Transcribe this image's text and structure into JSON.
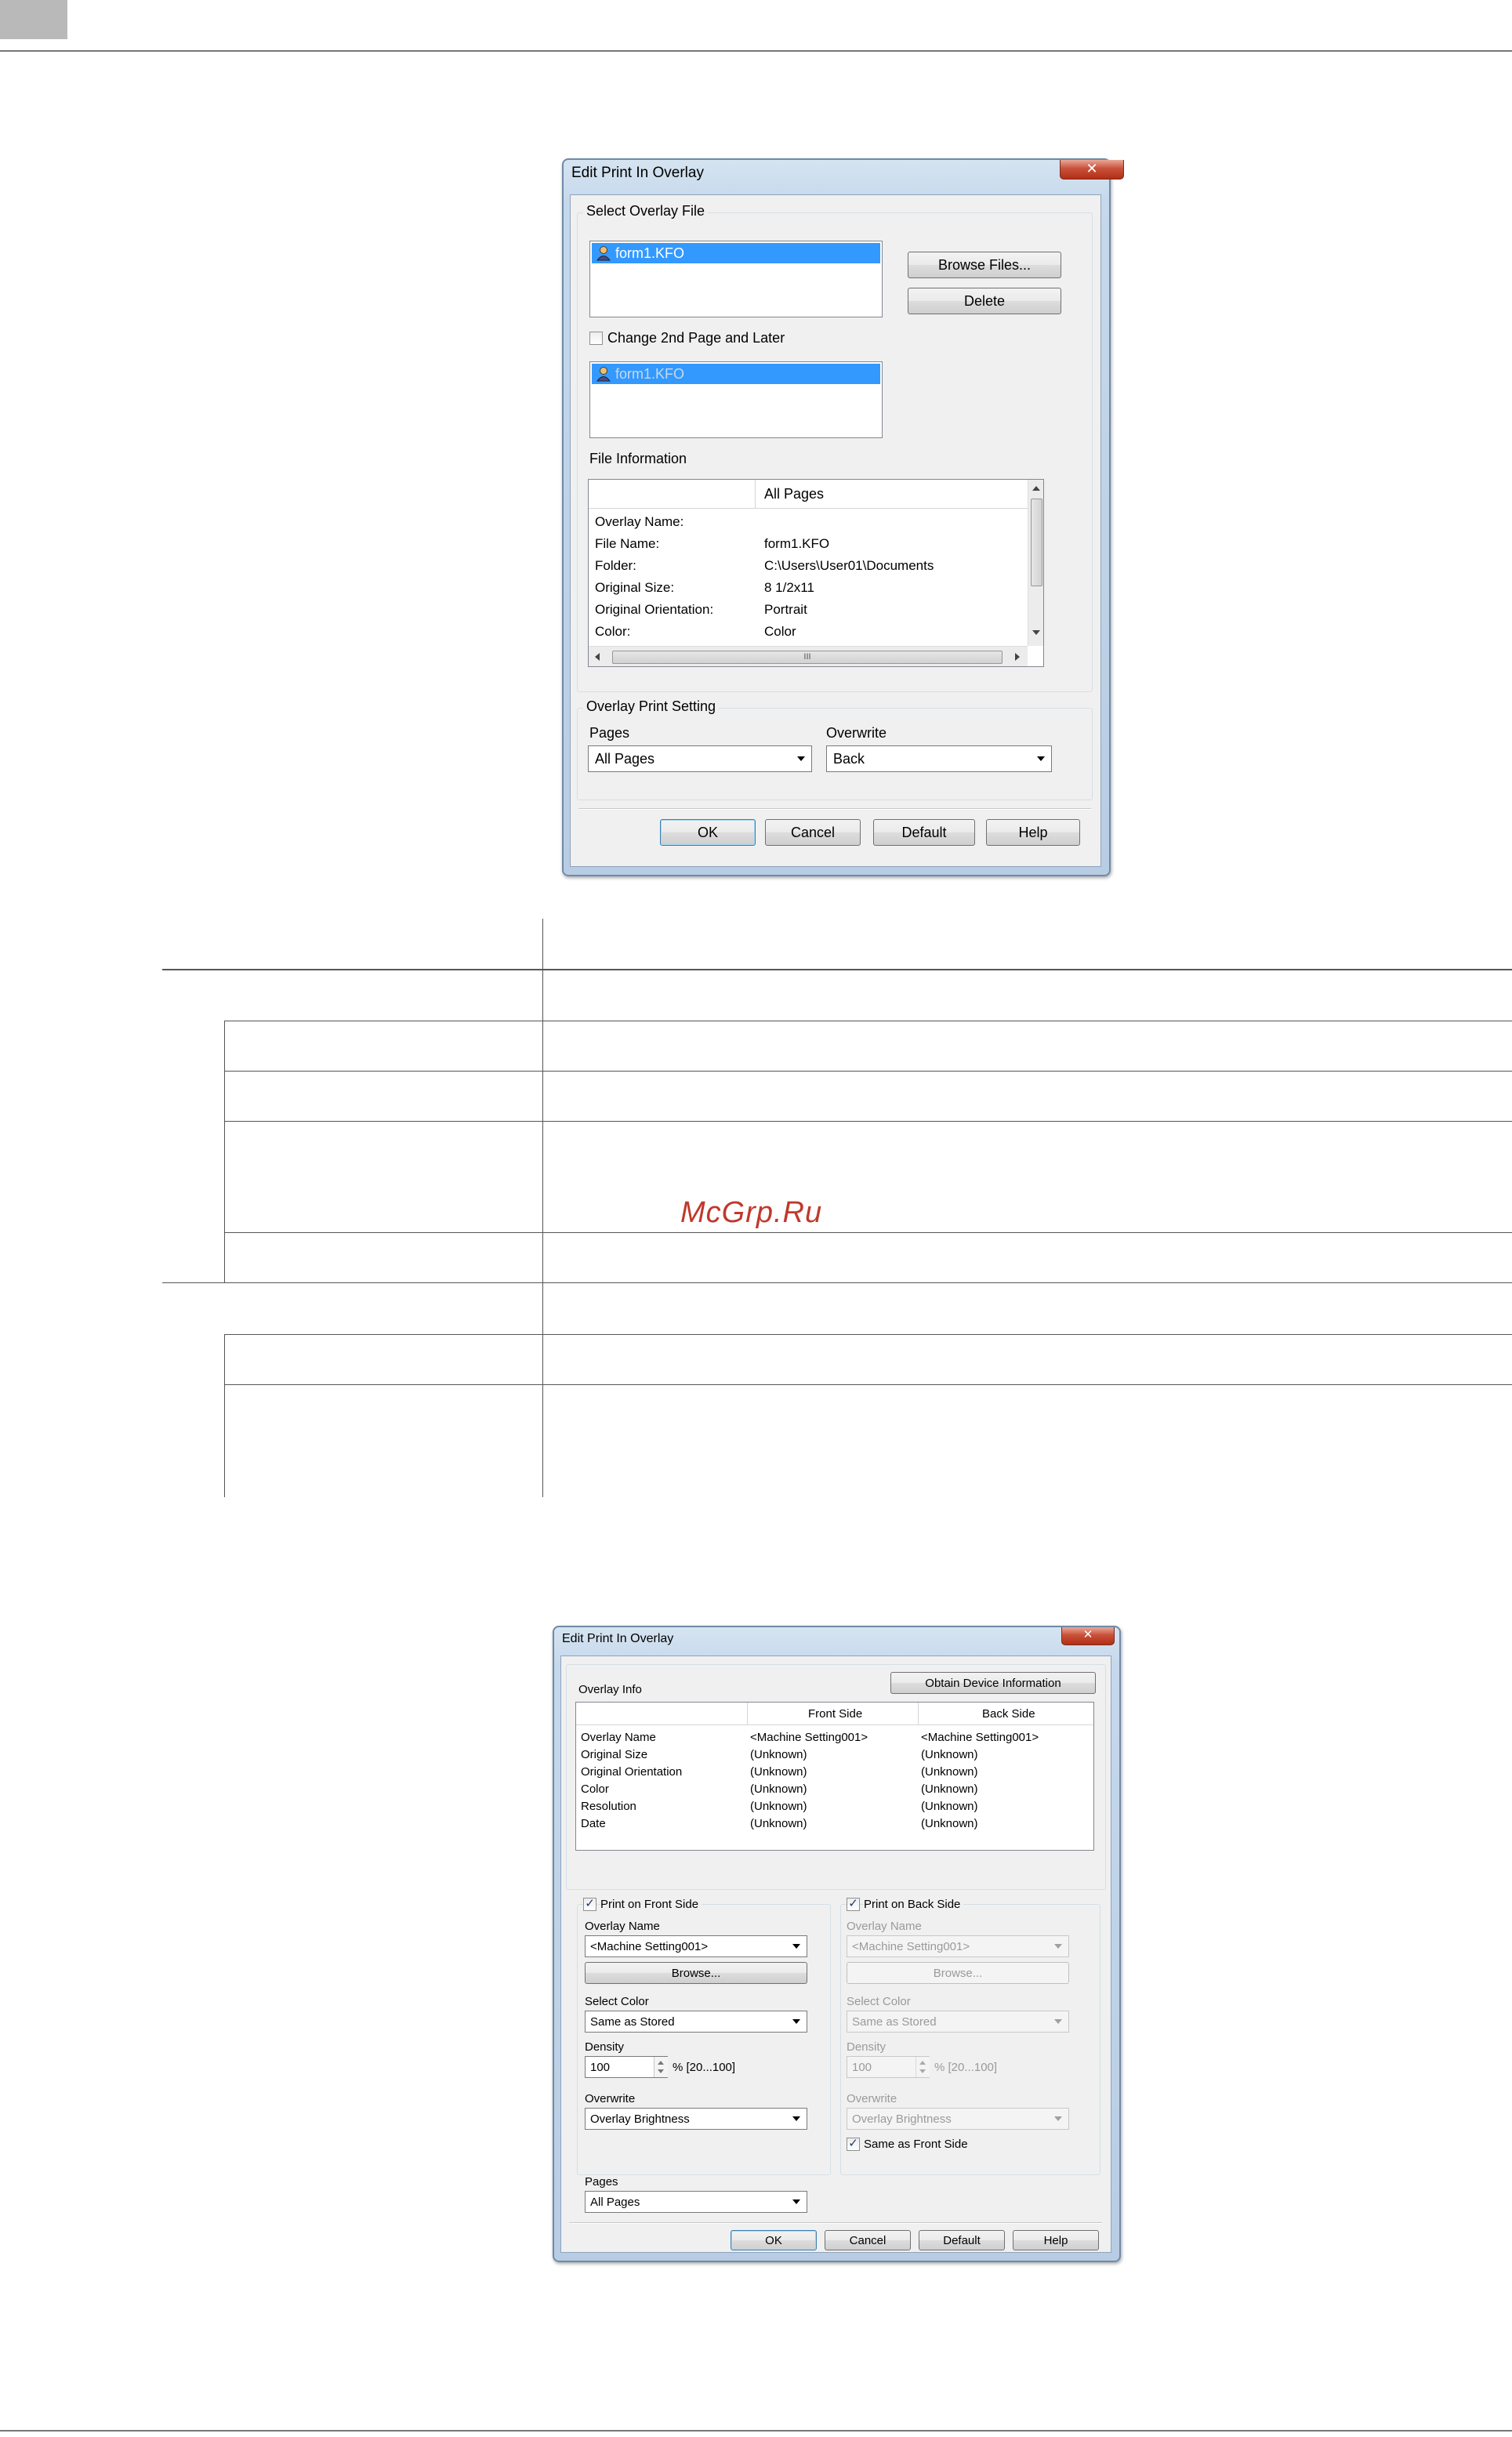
{
  "watermark": "McGrp.Ru",
  "dialog1": {
    "title": "Edit Print In Overlay",
    "close_glyph": "✕",
    "select_overlay_file": {
      "label": "Select Overlay File",
      "selected_file": "form1.KFO",
      "browse_button": "Browse Files...",
      "delete_button": "Delete"
    },
    "change_2nd_page": {
      "label": "Change 2nd Page and Later",
      "checked": false,
      "selected_file": "form1.KFO"
    },
    "file_information": {
      "label": "File Information",
      "column_header": "All Pages",
      "rows": [
        {
          "key": "Overlay Name:",
          "value": ""
        },
        {
          "key": "File Name:",
          "value": "form1.KFO"
        },
        {
          "key": "Folder:",
          "value": "C:\\Users\\User01\\Documents"
        },
        {
          "key": "Original Size:",
          "value": "8 1/2x11"
        },
        {
          "key": "Original Orientation:",
          "value": "Portrait"
        },
        {
          "key": "Color:",
          "value": "Color"
        }
      ],
      "hscroll_grip": "III"
    },
    "overlay_print_setting": {
      "label": "Overlay Print Setting",
      "pages_label": "Pages",
      "pages_value": "All Pages",
      "overwrite_label": "Overwrite",
      "overwrite_value": "Back"
    },
    "buttons": {
      "ok": "OK",
      "cancel": "Cancel",
      "default": "Default",
      "help": "Help"
    }
  },
  "dialog2": {
    "title": "Edit Print In Overlay",
    "close_glyph": "✕",
    "overlay_info": {
      "label": "Overlay Info",
      "obtain_button": "Obtain Device Information",
      "columns": [
        "",
        "Front Side",
        "Back Side"
      ],
      "rows": [
        {
          "key": "Overlay Name",
          "front": "<Machine Setting001>",
          "back": "<Machine Setting001>"
        },
        {
          "key": "Original Size",
          "front": "(Unknown)",
          "back": "(Unknown)"
        },
        {
          "key": "Original Orientation",
          "front": "(Unknown)",
          "back": "(Unknown)"
        },
        {
          "key": "Color",
          "front": "(Unknown)",
          "back": "(Unknown)"
        },
        {
          "key": "Resolution",
          "front": "(Unknown)",
          "back": "(Unknown)"
        },
        {
          "key": "Date",
          "front": "(Unknown)",
          "back": "(Unknown)"
        }
      ]
    },
    "front": {
      "print_label": "Print on Front Side",
      "checked": true,
      "overlay_name_label": "Overlay Name",
      "overlay_name_value": "<Machine Setting001>",
      "browse_button": "Browse...",
      "select_color_label": "Select Color",
      "select_color_value": "Same as Stored",
      "density_label": "Density",
      "density_value": "100",
      "density_range": "% [20...100]",
      "overwrite_label": "Overwrite",
      "overwrite_value": "Overlay Brightness"
    },
    "back": {
      "print_label": "Print on Back Side",
      "checked": true,
      "overlay_name_label": "Overlay Name",
      "overlay_name_value": "<Machine Setting001>",
      "browse_button": "Browse...",
      "select_color_label": "Select Color",
      "select_color_value": "Same as Stored",
      "density_label": "Density",
      "density_value": "100",
      "density_range": "% [20...100]",
      "overwrite_label": "Overwrite",
      "overwrite_value": "Overlay Brightness",
      "same_as_front_label": "Same as Front Side",
      "same_as_front_checked": true
    },
    "pages": {
      "label": "Pages",
      "value": "All Pages"
    },
    "buttons": {
      "ok": "OK",
      "cancel": "Cancel",
      "default": "Default",
      "help": "Help"
    }
  }
}
